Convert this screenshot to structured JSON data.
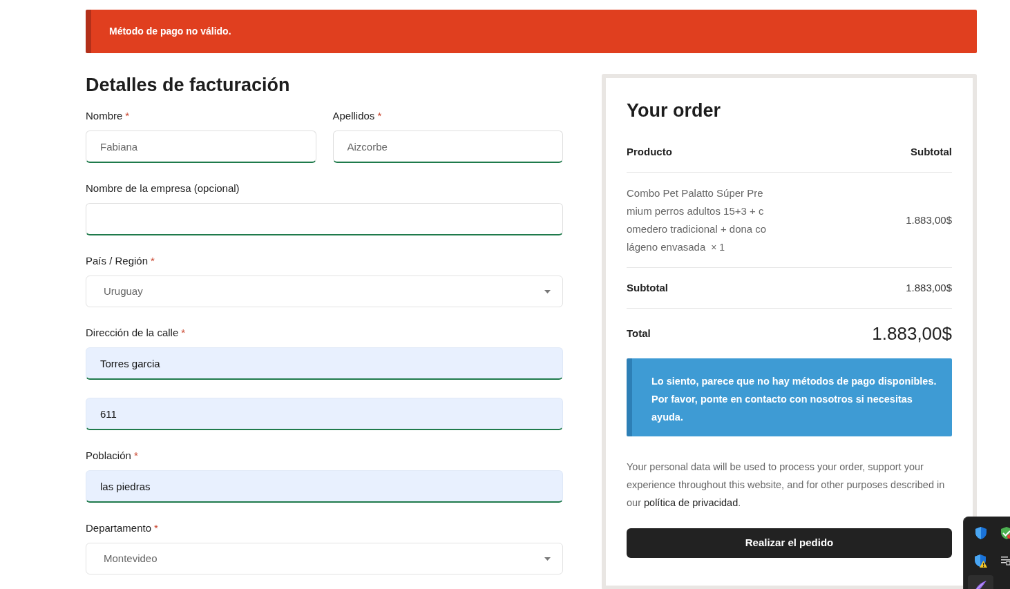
{
  "notice": {
    "kind": "error",
    "text": "Método de pago no válido."
  },
  "billing": {
    "title": "Detalles de facturación",
    "rows": [
      [
        {
          "kind": "text",
          "label": "Nombre",
          "required_mark": "*",
          "value": "Fabiana",
          "autofilled": false,
          "validated": true
        },
        {
          "kind": "text",
          "label": "Apellidos",
          "required_mark": "*",
          "value": "Aizcorbe",
          "autofilled": false,
          "validated": true
        }
      ],
      [
        {
          "kind": "text",
          "label": "Nombre de la empresa (opcional)",
          "autofilled": false,
          "validated": true
        }
      ],
      [
        {
          "kind": "select",
          "label": "País / Región",
          "required_mark": "*",
          "value": "Uruguay"
        }
      ],
      [
        {
          "kind": "text",
          "label": "Dirección de la calle",
          "required_mark": "*",
          "value": "Torres garcia",
          "autofilled": true,
          "validated": true
        }
      ],
      [
        {
          "kind": "text",
          "value": "611",
          "autofilled": true,
          "validated": true
        }
      ],
      [
        {
          "kind": "text",
          "label": "Población",
          "required_mark": "*",
          "value": "las piedras",
          "autofilled": true,
          "validated": true
        }
      ],
      [
        {
          "kind": "select",
          "label": "Departamento",
          "required_mark": "*",
          "value": "Montevideo"
        }
      ]
    ]
  },
  "order": {
    "title": "Your order",
    "columns": [
      "Producto",
      "Subtotal"
    ],
    "items": [
      {
        "name": "Combo Pet Palatto Súper Premium perros adultos 15+3 + comedero tradicional + dona colágeno envasada",
        "quantity": "× 1",
        "subtotal": "1.883,00$"
      }
    ],
    "totals": [
      {
        "kind": "subtotal",
        "label": "Subtotal",
        "value": "1.883,00$"
      },
      {
        "kind": "total",
        "label": "Total",
        "value": "1.883,00$"
      }
    ],
    "payment_notice": {
      "kind": "info",
      "text": "Lo siento, parece que no hay métodos de pago disponibles. Por favor, ponte en contacto con nosotros si necesitas ayuda."
    },
    "privacy": {
      "text_before": "Your personal data will be used to process your order, support your experience throughout this website, and for other purposes described in our ",
      "link": "política de privacidad",
      "text_after": "."
    },
    "button": "Realizar el pedido"
  }
}
